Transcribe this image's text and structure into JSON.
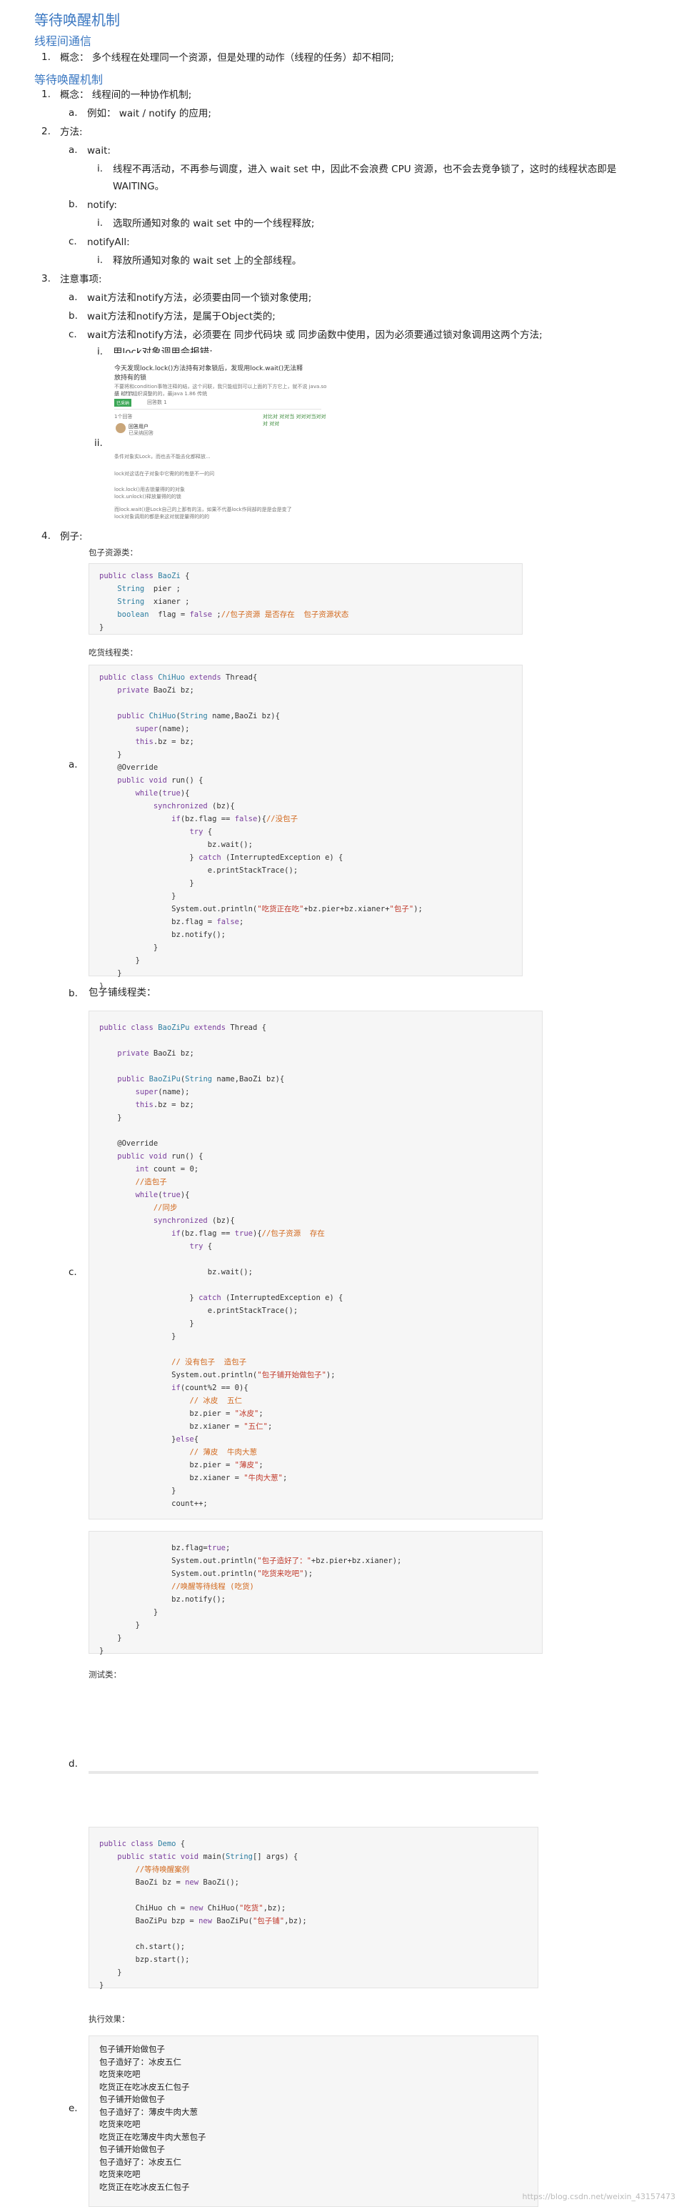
{
  "title": "等待唤醒机制",
  "section1": {
    "heading": "线程间通信",
    "item_num": "1.",
    "item_text": "概念： 多个线程在处理同一个资源，但是处理的动作（线程的任务）却不相同;"
  },
  "section2": {
    "heading": "等待唤醒机制",
    "items": [
      {
        "num": "1.",
        "text": "概念： 线程间的一种协作机制;"
      },
      {
        "num": "a.",
        "text": "例如： wait / notify 的应用;"
      },
      {
        "num": "2.",
        "text": "方法:"
      },
      {
        "num": "a.",
        "text": "wait:"
      },
      {
        "num": "i.",
        "text": "线程不再活动，不再参与调度，进入 wait set 中，因此不会浪费 CPU 资源，也不会去竞争锁了，这时的线程状态即是"
      },
      {
        "num": "",
        "text": "WAITING。"
      },
      {
        "num": "b.",
        "text": "notify:"
      },
      {
        "num": "i.",
        "text": "选取所通知对象的 wait set 中的一个线程释放;"
      },
      {
        "num": "c.",
        "text": "notifyAll:"
      },
      {
        "num": "i.",
        "text": "释放所通知对象的 wait set 上的全部线程。"
      },
      {
        "num": "3.",
        "text": "注意事项:"
      },
      {
        "num": "a.",
        "text": "wait方法和notify方法，必须要由同一个锁对象使用;"
      },
      {
        "num": "b.",
        "text": "wait方法和notify方法，是属于Object类的;"
      },
      {
        "num": "c.",
        "text": "wait方法和notify方法，必须要在 同步代码块 或 同步函数中使用，因为必须要通过锁对象调用这两个方法;"
      },
      {
        "num": "i.",
        "text": "用lock对象调用会报错;"
      },
      {
        "num": "ii.",
        "text": ""
      },
      {
        "num": "4.",
        "text": "例子:"
      }
    ]
  },
  "screenshot": {
    "q1": "今天发现lock.lock()方法持有对象锁后，发现用lock.wait()无法释",
    "q2": "放持有的锁",
    "d1": "不要将和condition事物注释的结，这个问联，我只能组到可以上面的下方它上，就不说 java.so是 87 传",
    "d2": "感 过性 组织调整的的，最java 1.86 传统",
    "tag": "已采纳",
    "meta": "回答数 1",
    "ans_count": "1个回答",
    "link": "对比对 对对当 对对对当对对对 对对",
    "user": "回答用户",
    "sub": "已采纳回答",
    "a1": "条件对象实Lock，而也去不能去化都释放...",
    "a2": "lock对这话在子对象中它需的的有是不一的问",
    "a3": "lock.lock()用去锁量得的的对象",
    "a4": "lock.unlock()释放量得的的锁",
    "a5": "而lock.wait()是Lock自己的上那有的法，如果不代基lock作同部的是是会是变了",
    "a6": "lock对象调用的都是来这对就提量得的的的"
  },
  "example": {
    "resource_label": "包子资源类：",
    "eater_label": "吃货线程类：",
    "shop_num": "b.",
    "shop_label": "包子铺线程类：",
    "test_label": "测试类：",
    "result_label": "执行效果：",
    "mark_a": "a.",
    "mark_c": "c.",
    "mark_d": "d.",
    "mark_e": "e."
  },
  "output_lines": [
    "包子铺开始做包子",
    "包子造好了：冰皮五仁",
    "吃货来吃吧",
    "吃货正在吃冰皮五仁包子",
    "包子铺开始做包子",
    "包子造好了：薄皮牛肉大葱",
    "吃货来吃吧",
    "吃货正在吃薄皮牛肉大葱包子",
    "包子铺开始做包子",
    "包子造好了：冰皮五仁",
    "吃货来吃吧",
    "吃货正在吃冰皮五仁包子"
  ],
  "watermark": "https://blog.csdn.net/weixin_43157473"
}
